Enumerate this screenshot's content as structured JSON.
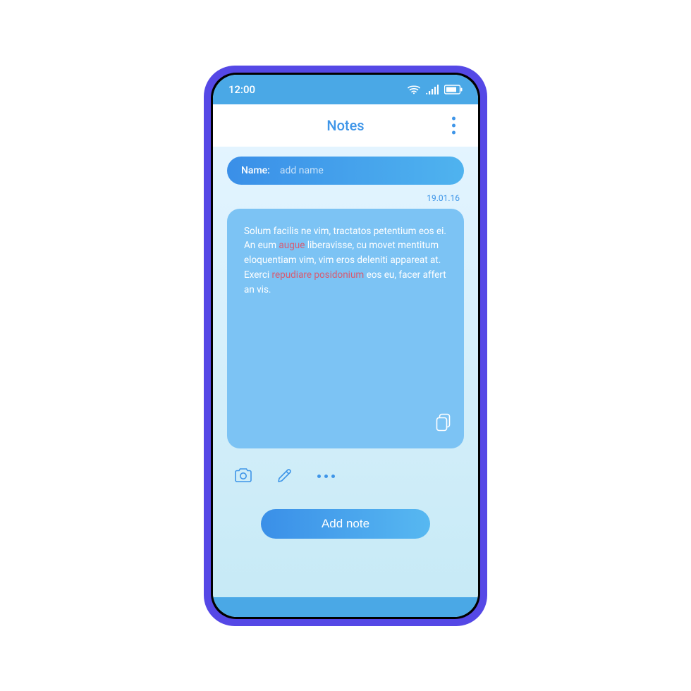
{
  "status": {
    "time": "12:00",
    "icons": {
      "wifi": "wifi-icon",
      "signal": "signal-icon",
      "battery": "battery-icon"
    }
  },
  "header": {
    "title": "Notes"
  },
  "name_field": {
    "label": "Name:",
    "placeholder": "add name"
  },
  "note": {
    "date": "19.01.16",
    "text_parts": {
      "p1": "Solum facilis ne vim, tractatos petentium eos ei. An eum ",
      "h1": "augue",
      "p2": " liberavisse, cu movet mentitum eloquentiam vim, vim eros deleniti appareat at. Exerci ",
      "h2": "repudiare posidonium",
      "p3": " eos eu, facer affert an vis."
    }
  },
  "toolbar": {
    "camera": "camera-icon",
    "pencil": "pencil-icon",
    "more": "more-icon"
  },
  "actions": {
    "add_note": "Add note"
  },
  "colors": {
    "accent": "#3e95e8",
    "frame": "#5548e6",
    "card": "#7cc3f4",
    "highlight": "#d85a70"
  }
}
